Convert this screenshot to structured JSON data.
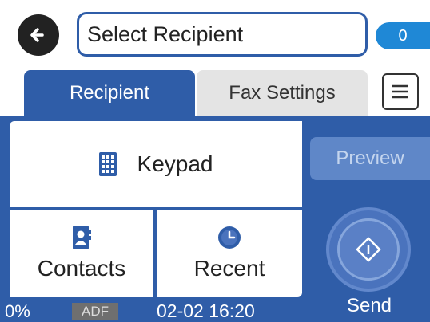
{
  "header": {
    "recipient_field_text": "Select Recipient",
    "recipient_count": "0"
  },
  "tabs": [
    {
      "label": "Recipient",
      "selected": true
    },
    {
      "label": "Fax Settings",
      "selected": false
    }
  ],
  "options": {
    "keypad_label": "Keypad",
    "contacts_label": "Contacts",
    "recent_label": "Recent"
  },
  "actions": {
    "preview_label": "Preview",
    "send_label": "Send"
  },
  "status": {
    "percent": "0%",
    "source_badge": "ADF",
    "datetime": "02-02 16:20"
  },
  "icons": {
    "back": "arrow-left-icon",
    "menu": "list-menu-icon",
    "keypad": "keypad-grid-icon",
    "contacts": "contact-card-icon",
    "recent": "clock-icon",
    "send": "diamond-start-icon"
  },
  "colors": {
    "accent_blue": "#2f5da8",
    "badge_blue": "#1f88d6",
    "tab_inactive": "#e4e4e4",
    "preview_disabled": "#5f87c8"
  }
}
